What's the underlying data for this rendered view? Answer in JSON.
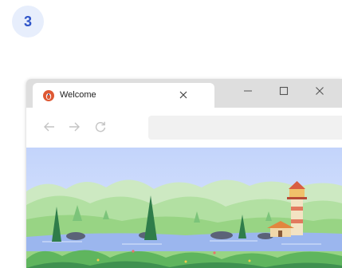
{
  "step": {
    "number": "3"
  },
  "browser": {
    "tab": {
      "title": "Welcome",
      "favicon": "duckduckgo-logo-icon"
    },
    "window_controls": [
      "minimize-icon",
      "maximize-icon",
      "close-icon"
    ],
    "nav": [
      "back-arrow-icon",
      "forward-arrow-icon",
      "reload-icon"
    ],
    "address": {
      "value": ""
    }
  },
  "colors": {
    "accent": "#2f55c9",
    "badge_bg": "#e7eefc",
    "tabbar_bg": "#dedede",
    "favicon": "#de5833",
    "sky": "#c6d7fb",
    "water": "#9bb6ee"
  }
}
